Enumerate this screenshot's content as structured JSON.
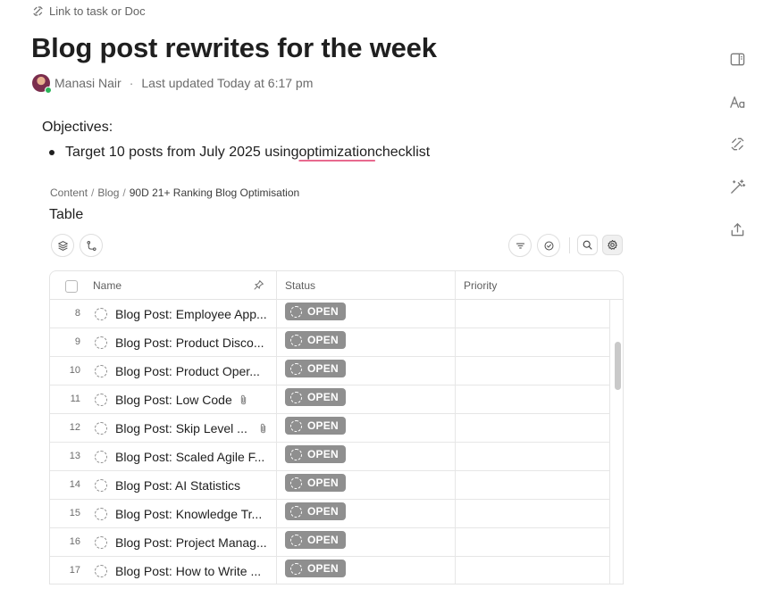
{
  "header": {
    "link_text": "Link to task or Doc",
    "title": "Blog post rewrites for the week",
    "author": "Manasi Nair",
    "separator": "·",
    "last_updated": "Last updated Today at 6:17 pm"
  },
  "content": {
    "objectives_label": "Objectives:",
    "bullet_before": "Target 10 posts from July 2025 using ",
    "bullet_underlined": "optimization",
    "bullet_after": " checklist"
  },
  "breadcrumb": {
    "items": [
      "Content",
      "Blog",
      "90D 21+ Ranking Blog Optimisation"
    ],
    "separator": "/"
  },
  "view": {
    "title": "Table"
  },
  "table": {
    "columns": {
      "name": "Name",
      "status": "Status",
      "priority": "Priority"
    },
    "rows": [
      {
        "num": "8",
        "name": "Blog Post: Employee App...",
        "status": "OPEN",
        "attachment": false
      },
      {
        "num": "9",
        "name": "Blog Post: Product Disco...",
        "status": "OPEN",
        "attachment": false
      },
      {
        "num": "10",
        "name": "Blog Post: Product Oper...",
        "status": "OPEN",
        "attachment": false
      },
      {
        "num": "11",
        "name": "Blog Post: Low Code",
        "status": "OPEN",
        "attachment": true
      },
      {
        "num": "12",
        "name": "Blog Post: Skip Level ...",
        "status": "OPEN",
        "attachment": true
      },
      {
        "num": "13",
        "name": "Blog Post: Scaled Agile F...",
        "status": "OPEN",
        "attachment": false
      },
      {
        "num": "14",
        "name": "Blog Post: AI Statistics",
        "status": "OPEN",
        "attachment": false
      },
      {
        "num": "15",
        "name": "Blog Post: Knowledge Tr...",
        "status": "OPEN",
        "attachment": false
      },
      {
        "num": "16",
        "name": "Blog Post: Project Manag...",
        "status": "OPEN",
        "attachment": false
      },
      {
        "num": "17",
        "name": "Blog Post: How to Write ...",
        "status": "OPEN",
        "attachment": false
      }
    ]
  },
  "icons": {
    "link": "link-icon",
    "layers": "layers-icon",
    "route": "route-icon",
    "filter": "filter-icon",
    "check": "check-circle-icon",
    "search": "search-icon",
    "settings": "gear-icon",
    "pin": "pin-icon",
    "attachment": "paperclip-icon",
    "panel": "panel-icon",
    "typography": "typography-icon",
    "rail_link": "link-icon",
    "magic": "magic-wand-icon",
    "share": "share-icon"
  },
  "colors": {
    "status_open": "#8f8f8f",
    "spell_underline": "#e86a8e",
    "presence": "#2bb45a"
  }
}
